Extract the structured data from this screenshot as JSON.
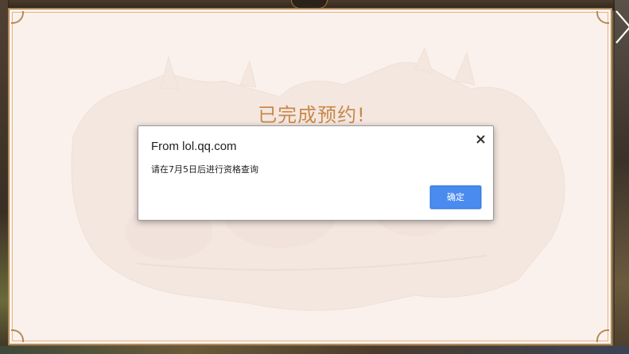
{
  "panel": {
    "title": "已完成预约!",
    "close_icon": "close-icon"
  },
  "dialog": {
    "title": "From lol.qq.com",
    "message": "请在7月5日后进行资格查询",
    "ok_label": "确定",
    "close_icon": "close-icon"
  },
  "colors": {
    "panel_background": "#fbf1ec",
    "panel_border": "#b48a55",
    "title_text": "#c8884a",
    "ok_button": "#4a8bf0"
  }
}
